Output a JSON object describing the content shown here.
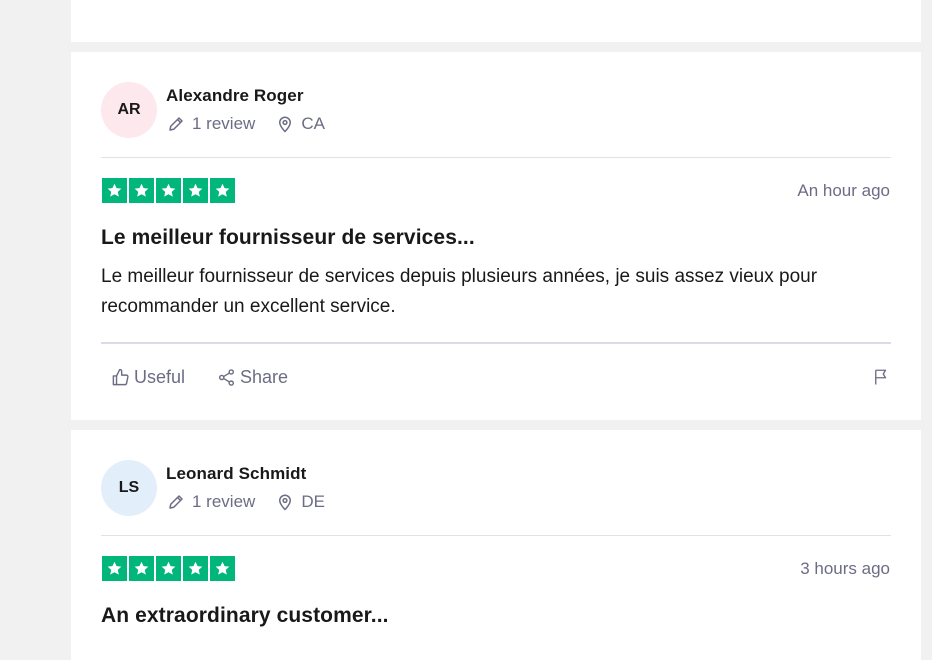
{
  "colors": {
    "background": "#f1f1f2",
    "card": "#ffffff",
    "star_green": "#00b67a",
    "muted_text": "#6c6c85",
    "avatar_ar": "#fde8ee",
    "avatar_ls": "#e3eefb"
  },
  "reviews": [
    {
      "initials": "AR",
      "name": "Alexandre Roger",
      "review_count": "1 review",
      "country": "CA",
      "rating": 5,
      "date": "An hour ago",
      "title": "Le meilleur fournisseur de services...",
      "body": "Le meilleur fournisseur de services depuis plusieurs années, je suis assez vieux pour recommander un excellent service.",
      "useful_label": "Useful",
      "share_label": "Share"
    },
    {
      "initials": "LS",
      "name": "Leonard Schmidt",
      "review_count": "1 review",
      "country": "DE",
      "rating": 5,
      "date": "3 hours ago",
      "title": "An extraordinary customer..."
    }
  ]
}
